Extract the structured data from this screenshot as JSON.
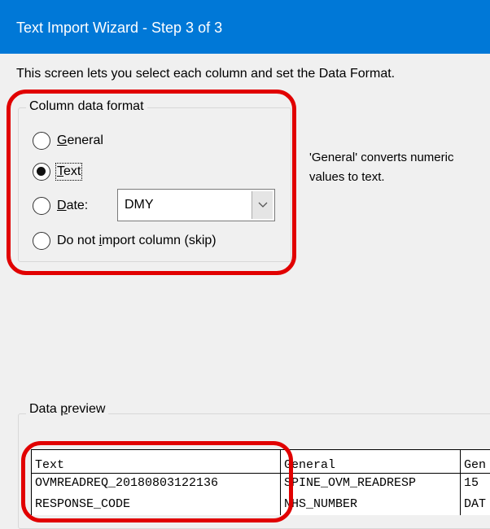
{
  "window": {
    "title": "Text Import Wizard - Step 3 of 3"
  },
  "instructions": "This screen lets you select each column and set the Data Format.",
  "column_format": {
    "legend": "Column data format",
    "options": [
      {
        "pre": "",
        "key": "G",
        "post": "eneral",
        "checked": false
      },
      {
        "pre": "",
        "key": "T",
        "post": "ext",
        "checked": true
      },
      {
        "pre": "",
        "key": "D",
        "post": "ate:",
        "checked": false
      },
      {
        "pre": "Do not ",
        "key": "i",
        "post": "mport column (skip)",
        "checked": false
      }
    ],
    "date_format": "DMY"
  },
  "description": {
    "line1": "'General' converts numeric",
    "line2": "values to text."
  },
  "preview": {
    "legend_pre": "Data ",
    "legend_key": "p",
    "legend_post": "review",
    "columns": [
      {
        "header": "Text",
        "rows": [
          "OVMREADREQ_20180803122136",
          "RESPONSE_CODE"
        ]
      },
      {
        "header": "General",
        "rows": [
          "SPINE_OVM_READRESP",
          "NHS_NUMBER"
        ]
      },
      {
        "header": "Gen",
        "rows": [
          "15",
          "DAT"
        ]
      }
    ]
  },
  "colors": {
    "titlebar": "#0078d7",
    "highlight": "#e10000"
  }
}
